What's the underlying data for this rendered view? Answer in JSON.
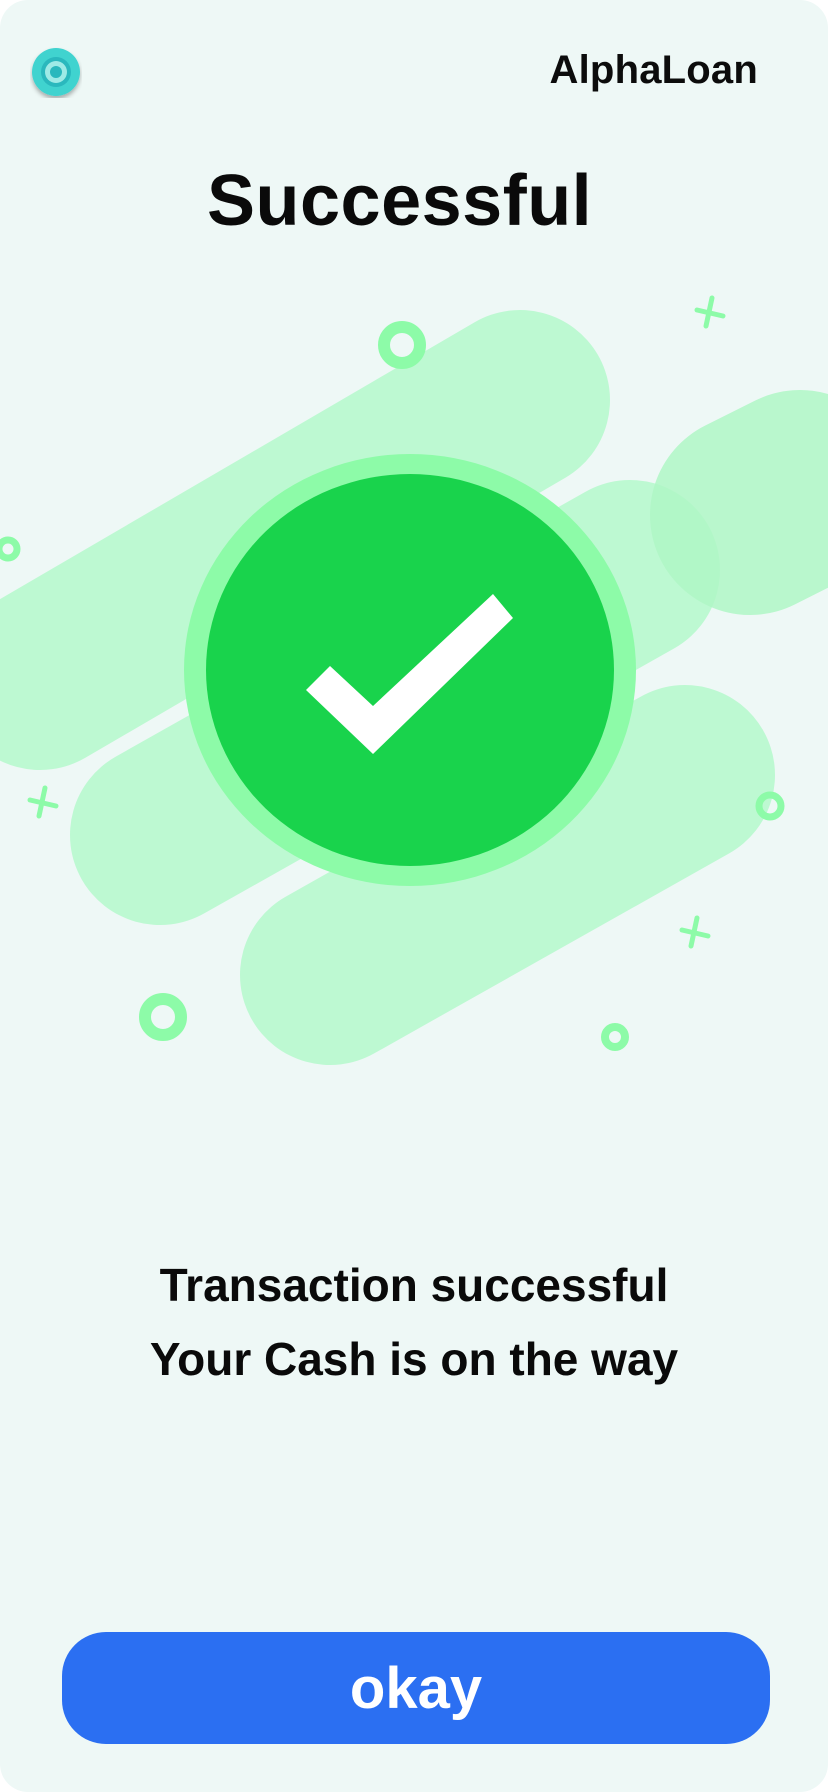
{
  "header": {
    "logo_icon": "target-icon",
    "brand_name": "AlphaLoan"
  },
  "status": {
    "title": "Successful",
    "icon": "check-circle-icon"
  },
  "message": {
    "line1": "Transaction successful",
    "line2": "Your Cash is on the way"
  },
  "actions": {
    "okay_label": "okay"
  },
  "colors": {
    "background": "#eef8f6",
    "success_green": "#19d34c",
    "success_ring": "#8dfba8",
    "blob_green": "#bdf9d2",
    "primary_button": "#2b6ff2",
    "logo_teal": "#3fd3cf"
  }
}
